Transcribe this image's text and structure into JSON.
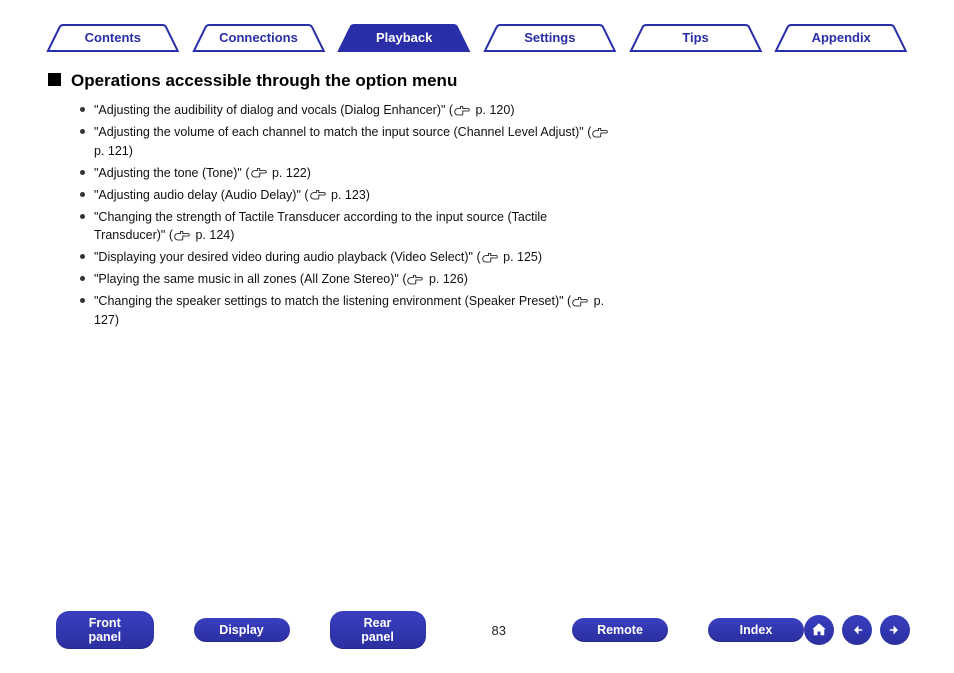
{
  "tabs": [
    {
      "label": "Contents",
      "active": false
    },
    {
      "label": "Connections",
      "active": false
    },
    {
      "label": "Playback",
      "active": true
    },
    {
      "label": "Settings",
      "active": false
    },
    {
      "label": "Tips",
      "active": false
    },
    {
      "label": "Appendix",
      "active": false
    }
  ],
  "heading": "Operations accessible through the option menu",
  "bullets": [
    {
      "text_pre": "\"Adjusting the audibility of dialog and vocals (Dialog Enhancer)\" (",
      "page": "p. 120",
      "text_post": ")"
    },
    {
      "text_pre": "\"Adjusting the volume of each channel to match the input source (Channel Level Adjust)\" (",
      "page": "p. 121",
      "text_post": ")"
    },
    {
      "text_pre": "\"Adjusting the tone (Tone)\" (",
      "page": "p. 122",
      "text_post": ")"
    },
    {
      "text_pre": "\"Adjusting audio delay (Audio Delay)\" (",
      "page": "p. 123",
      "text_post": ")"
    },
    {
      "text_pre": "\"Changing the strength of Tactile Transducer according to the input source (Tactile Transducer)\" (",
      "page": "p. 124",
      "text_post": ")"
    },
    {
      "text_pre": "\"Displaying your desired video during audio playback (Video Select)\" (",
      "page": "p. 125",
      "text_post": ")"
    },
    {
      "text_pre": "\"Playing the same music in all zones (All Zone Stereo)\" (",
      "page": "p. 126",
      "text_post": ")"
    },
    {
      "text_pre": "\"Changing the speaker settings to match the listening environment (Speaker Preset)\" (",
      "page": "p. 127",
      "text_post": ")"
    }
  ],
  "bottom_buttons": {
    "front_panel": "Front panel",
    "display": "Display",
    "rear_panel": "Rear panel",
    "remote": "Remote",
    "index": "Index"
  },
  "page_number": "83"
}
